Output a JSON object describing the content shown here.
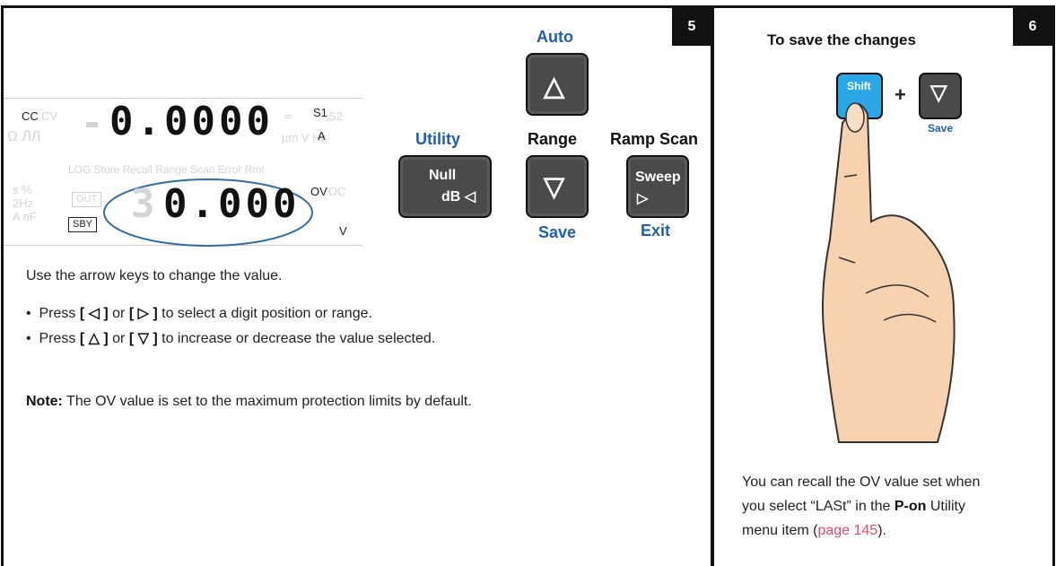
{
  "left_panel": {
    "step": "5",
    "lcd": {
      "mode_cc": "CC",
      "mode_cv_ghost": "CV",
      "top_value": "0.0000",
      "s1": "S1",
      "s2_ghost": "S2",
      "unit_a": "A",
      "ghost_row": "LOG  Store  Recall  Range  Scan  Error   Rmt",
      "ghost_units": "µm V Hz",
      "ov": "OV",
      "oc_ghost": "OC",
      "out_ghost": "OUT",
      "sby": "SBY",
      "bottom_ghost_digit": "3",
      "bottom_value": "0.000",
      "unit_v": "V"
    },
    "keys": {
      "auto_label": "Auto",
      "utility_label": "Utility",
      "range_label": "Range",
      "ramp_scan_label": "Ramp Scan",
      "null_text": "Null",
      "db_text": "dB ◁",
      "sweep_text": "Sweep",
      "sweep_arrow": "▷",
      "save_label": "Save",
      "exit_label": "Exit",
      "up_arrow": "△",
      "down_arrow": "▽"
    },
    "instructions": {
      "intro": "Use the arrow keys to change the value.",
      "bullet1_pre": "Press ",
      "bullet1_k1": "[ ◁ ]",
      "bullet1_mid": " or ",
      "bullet1_k2": "[ ▷ ]",
      "bullet1_post": " to select a digit position or range.",
      "bullet2_pre": "Press ",
      "bullet2_k1": "[ △ ]",
      "bullet2_mid": " or ",
      "bullet2_k2": "[ ▽ ]",
      "bullet2_post": " to increase or decrease the value selected.",
      "note_label": "Note:",
      "note_text": " The OV value is set to the maximum protection limits by default."
    }
  },
  "right_panel": {
    "step": "6",
    "heading": "To save the changes",
    "shift_key": "Shift",
    "plus": "+",
    "down_arrow": "▽",
    "save_label": "Save",
    "para_line1": "You can recall the OV value set when",
    "para_line2_pre": "you select “LASt” in the ",
    "para_line2_bold": "P-on",
    "para_line2_post": " Utility",
    "para_line3_pre": "menu item (",
    "para_line3_link": "page 145",
    "para_line3_post": ")."
  },
  "colors": {
    "accent_blue": "#1f5fb4",
    "link_red": "#e04b6c",
    "key_grey": "#4a4a4a",
    "shift_blue": "#2aa7e6",
    "skin": "#f6d2b0"
  }
}
